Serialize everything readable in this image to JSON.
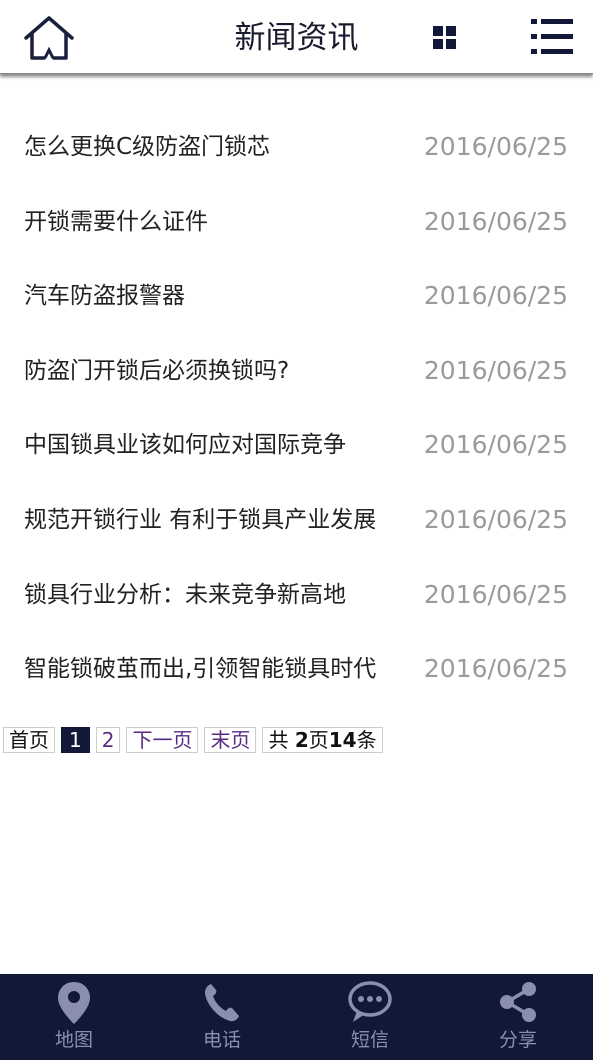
{
  "header": {
    "title": "新闻资讯",
    "home_icon": "home-icon",
    "grid_icon": "grid-icon",
    "menu_icon": "list-menu-icon"
  },
  "news": [
    {
      "title": "怎么更换C级防盗门锁芯",
      "date": "2016/06/25"
    },
    {
      "title": "开锁需要什么证件",
      "date": "2016/06/25"
    },
    {
      "title": "汽车防盗报警器",
      "date": "2016/06/25"
    },
    {
      "title": "防盗门开锁后必须换锁吗?",
      "date": "2016/06/25"
    },
    {
      "title": "中国锁具业该如何应对国际竞争",
      "date": "2016/06/25"
    },
    {
      "title": "规范开锁行业 有利于锁具产业发展",
      "date": "2016/06/25"
    },
    {
      "title": "锁具行业分析：未来竞争新高地",
      "date": "2016/06/25"
    },
    {
      "title": "智能锁破茧而出,引领智能锁具时代",
      "date": "2016/06/25"
    }
  ],
  "pager": {
    "first": "首页",
    "current": "1",
    "page2": "2",
    "next": "下一页",
    "last": "末页",
    "total_prefix": "共 ",
    "total_pages": "2",
    "page_unit": "页",
    "total_items": "14",
    "item_unit": "条"
  },
  "footer": {
    "items": [
      {
        "label": "地图",
        "icon": "map-pin-icon"
      },
      {
        "label": "电话",
        "icon": "phone-icon"
      },
      {
        "label": "短信",
        "icon": "chat-bubble-icon"
      },
      {
        "label": "分享",
        "icon": "share-icon"
      }
    ]
  },
  "colors": {
    "dark_navy": "#121838",
    "footer_label": "#8b8fae",
    "date_gray": "#9a9a9a",
    "link_purple": "#5a2a82"
  }
}
